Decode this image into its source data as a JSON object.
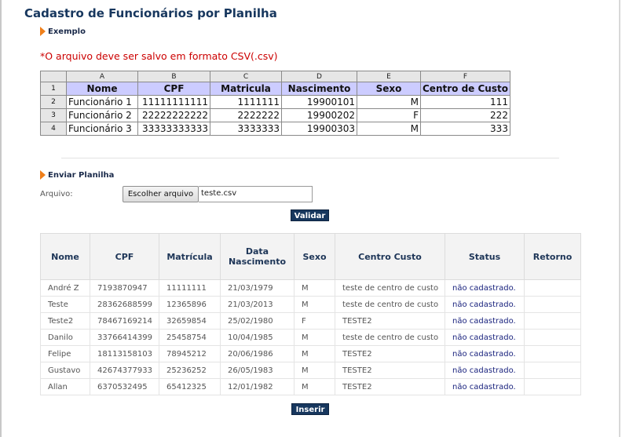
{
  "page_title": "Cadastro de Funcionários por Planilha",
  "example_section": {
    "label": "Exemplo"
  },
  "warning": "*O arquivo deve ser salvo em formato CSV(.csv)",
  "spreadsheet": {
    "column_letters": [
      "A",
      "B",
      "C",
      "D",
      "E",
      "F"
    ],
    "headers": [
      "Nome",
      "CPF",
      "Matricula",
      "Nascimento",
      "Sexo",
      "Centro de Custo"
    ],
    "row_numbers": [
      "1",
      "2",
      "3",
      "4"
    ],
    "rows": [
      [
        "Funcionário 1",
        "11111111111",
        "1111111",
        "19900101",
        "M",
        "111"
      ],
      [
        "Funcionário 2",
        "22222222222",
        "2222222",
        "19900202",
        "F",
        "222"
      ],
      [
        "Funcionário 3",
        "33333333333",
        "3333333",
        "19900303",
        "M",
        "333"
      ]
    ]
  },
  "upload_section": {
    "label": "Enviar Planilha",
    "file_label": "Arquivo:",
    "choose_button": "Escolher arquivo",
    "file_name": "teste.csv",
    "validate_button": "Validar"
  },
  "results": {
    "headers": [
      "Nome",
      "CPF",
      "Matrícula",
      "Data Nascimento",
      "Sexo",
      "Centro Custo",
      "Status",
      "Retorno"
    ],
    "rows": [
      [
        "André Z",
        "7193870947",
        "11111111",
        "21/03/1979",
        "M",
        "teste de centro de custo",
        "não cadastrado.",
        ""
      ],
      [
        "Teste",
        "28362688599",
        "12365896",
        "21/03/2013",
        "M",
        "teste de centro de custo",
        "não cadastrado.",
        ""
      ],
      [
        "Teste2",
        "78467169214",
        "32659854",
        "25/02/1980",
        "F",
        "TESTE2",
        "não cadastrado.",
        ""
      ],
      [
        "Danilo",
        "33766414399",
        "25458754",
        "10/04/1985",
        "M",
        "teste de centro de custo",
        "não cadastrado.",
        ""
      ],
      [
        "Felipe",
        "18113158103",
        "78945212",
        "20/06/1986",
        "M",
        "TESTE2",
        "não cadastrado.",
        ""
      ],
      [
        "Gustavo",
        "42674377933",
        "25236252",
        "26/05/1983",
        "M",
        "TESTE2",
        "não cadastrado.",
        ""
      ],
      [
        "Allan",
        "6370532495",
        "65412325",
        "12/01/1982",
        "M",
        "TESTE2",
        "não cadastrado.",
        ""
      ]
    ],
    "insert_button": "Inserir"
  },
  "colors": {
    "title": "#17375e",
    "accent_arrow": "#ef7f1a",
    "warning": "#cc0000",
    "button": "#17375e",
    "sheet_header": "#ccccff"
  },
  "icons": {
    "section_bullet": "orange-triangle-icon"
  }
}
